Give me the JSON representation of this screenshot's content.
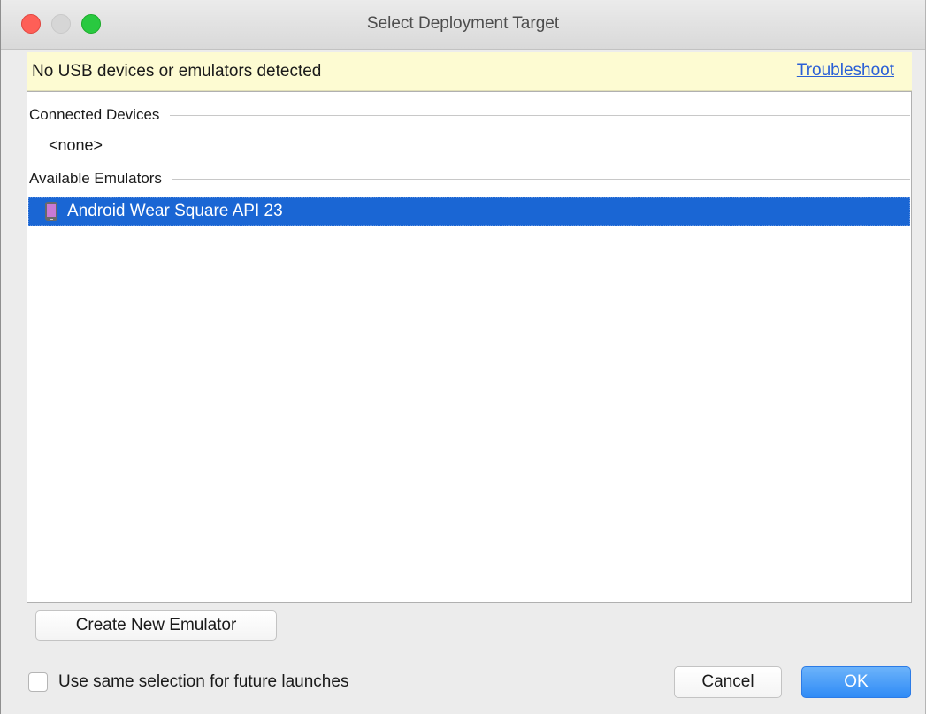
{
  "window": {
    "title": "Select Deployment Target"
  },
  "banner": {
    "message": "No USB devices or emulators detected",
    "link_label": "Troubleshoot"
  },
  "device_list": {
    "connected_header": "Connected Devices",
    "connected_empty": "<none>",
    "emulators_header": "Available Emulators",
    "emulators": [
      {
        "label": "Android Wear Square API 23",
        "icon": "wearable-device-icon",
        "selected": true
      }
    ]
  },
  "buttons": {
    "create_label": "Create New Emulator",
    "cancel_label": "Cancel",
    "ok_label": "OK"
  },
  "options": {
    "same_selection_label": "Use same selection for future launches",
    "same_selection_checked": false
  },
  "colors": {
    "banner_bg": "#fdfbd2",
    "selection": "#1a66d4",
    "primary_button": "#2f8bf6",
    "link": "#2a5fd6"
  }
}
